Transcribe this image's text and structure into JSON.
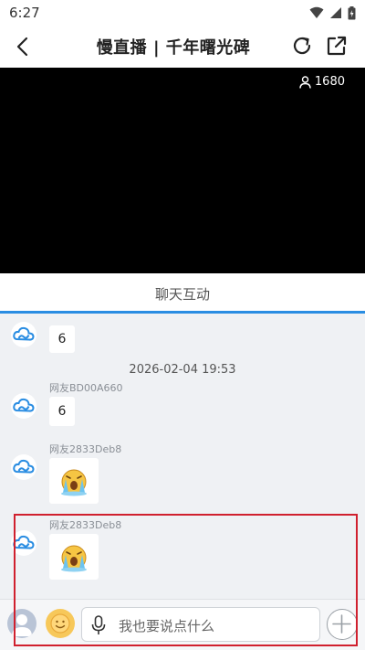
{
  "status_bar": {
    "time": "6:27"
  },
  "app_bar": {
    "title": "慢直播 | 千年曙光碑"
  },
  "video": {
    "viewer_count": "1680"
  },
  "tabs": {
    "active_label": "聊天互动"
  },
  "chat": {
    "messages": [
      {
        "username": "",
        "text": "6"
      },
      {
        "timestamp": "2026-02-04 19:53"
      },
      {
        "username": "网友BD00A660",
        "text": "6"
      },
      {
        "username": "网友2833Deb8",
        "sticker": "crying-face-sticker"
      },
      {
        "username": "网友2833Deb8",
        "sticker": "crying-face-sticker"
      }
    ]
  },
  "input_bar": {
    "placeholder": "我也要说点什么"
  },
  "colors": {
    "accent": "#2a8de2",
    "highlight": "#d0202e"
  }
}
